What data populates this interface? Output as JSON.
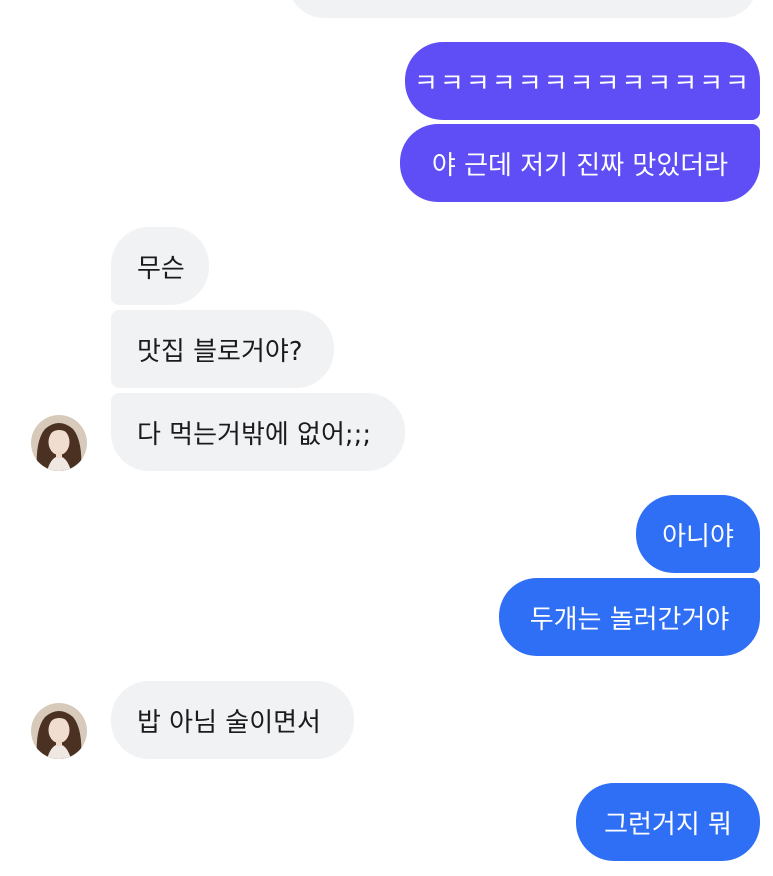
{
  "colors": {
    "outgoing_purple": "#5f4df6",
    "outgoing_blue": "#2f6ff5",
    "incoming_bg": "#f1f2f4"
  },
  "messages": [
    {
      "id": "m1",
      "side": "out",
      "color": "purple",
      "text": "ㅋㅋㅋㅋㅋㅋㅋㅋㅋㅋㅋㅋㅋ"
    },
    {
      "id": "m2",
      "side": "out",
      "color": "purple",
      "text": "야 근데 저기 진짜 맛있더라"
    },
    {
      "id": "m3",
      "side": "in",
      "text": "무슨"
    },
    {
      "id": "m4",
      "side": "in",
      "text": "맛집 블로거야?"
    },
    {
      "id": "m5",
      "side": "in",
      "text": "다 먹는거밖에 없어;;;"
    },
    {
      "id": "m6",
      "side": "out",
      "color": "blue",
      "text": "아니야"
    },
    {
      "id": "m7",
      "side": "out",
      "color": "blue",
      "text": "두개는 놀러간거야"
    },
    {
      "id": "m8",
      "side": "in",
      "text": "밥 아님 술이면서"
    },
    {
      "id": "m9",
      "side": "out",
      "color": "blue",
      "text": "그런거지 뭐"
    }
  ],
  "avatar_icon": "profile-photo"
}
